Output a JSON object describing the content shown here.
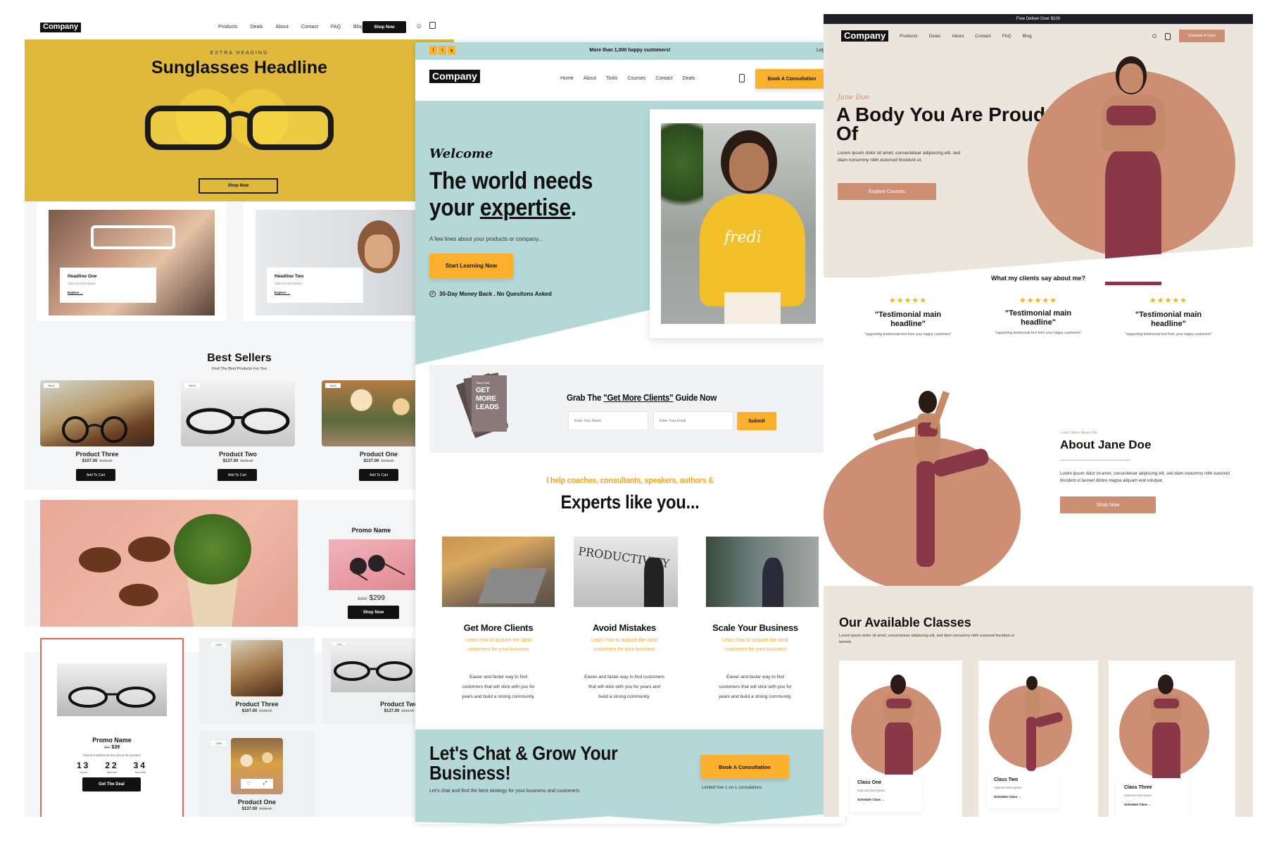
{
  "eyewear": {
    "logo": "Company",
    "nav": [
      "Products",
      "Deals",
      "About",
      "Contact",
      "FAQ",
      "Blog"
    ],
    "nav_cta": "Shop Now",
    "hero": {
      "eyebrow": "EXTRA HEADING",
      "title": "Sunglasses Headline",
      "cta": "Shop Now",
      "bg_color": "#e0b93c"
    },
    "features": [
      {
        "title": "Headline One",
        "desc": "Optional description",
        "link": "Explore →"
      },
      {
        "title": "Headline Two",
        "desc": "Optional description",
        "link": "Explore →"
      }
    ],
    "best_sellers": {
      "title": "Best Sellers",
      "subtitle": "Find The Best Products For You",
      "badge": "SALE",
      "products": [
        {
          "name": "Product Three",
          "price": "$107.00",
          "old_price": "$128.00",
          "cta": "Add To Cart"
        },
        {
          "name": "Product Two",
          "price": "$137.00",
          "old_price": "$158.00",
          "cta": "Add To Cart"
        },
        {
          "name": "Product One",
          "price": "$137.00",
          "old_price": "$168.00",
          "cta": "Add To Cart"
        }
      ]
    },
    "promo": {
      "title": "Promo Name",
      "old_price": "$399",
      "price": "$299",
      "cta": "Shop Now"
    },
    "deal": {
      "title": "Promo Name",
      "old_price": "$59",
      "price": "$39",
      "desc": "Optional additional text about the product",
      "countdown": [
        {
          "value": "13",
          "label": "Hours"
        },
        {
          "value": "22",
          "label": "Minutes"
        },
        {
          "value": "34",
          "label": "Seconds"
        }
      ],
      "cta": "Get The Deal"
    },
    "mini_products": [
      {
        "name": "Product Three",
        "price": "$107.00",
        "old_price": "$128.00",
        "badge": "-15%"
      },
      {
        "name": "Product Two",
        "price": "$137.00",
        "old_price": "$158.00",
        "badge": "-15%"
      },
      {
        "name": "Product One",
        "price": "$137.00",
        "old_price": "$168.00",
        "badge": "-15%"
      }
    ]
  },
  "coach": {
    "topbar": {
      "text": "More than 1,000 happy customers!",
      "login": "Log In",
      "social": [
        "f",
        "t",
        "ig"
      ]
    },
    "logo": "Company",
    "nav": [
      "Home",
      "About",
      "Tools",
      "Courses",
      "Contact",
      "Deals"
    ],
    "nav_cta": "Book A Consultation",
    "hero": {
      "script": "Welcome",
      "title_line1": "The world needs",
      "title_line2_pre": "your ",
      "title_line2_underlined": "expertise",
      "title_line2_post": ".",
      "subtitle": "A few lines about your products or company...",
      "cta": "Start Learning Now",
      "guarantee": "30-Day Money Back . No Quesitons Asked",
      "sweater_text": "fredi",
      "accent_color": "#b4d8d8"
    },
    "optin": {
      "book_small": "Tools & Deal",
      "book_lines": [
        "GET",
        "MORE",
        "LEADS"
      ],
      "title_pre": "Grab The ",
      "title_link": "\"Get More Clients\"",
      "title_post": " Guide Now",
      "name_placeholder": "Enter Your Name",
      "email_placeholder": "Enter Your Email",
      "submit": "Submit"
    },
    "experts": {
      "eyebrow": "I help coaches, consultants, speakers, authors &",
      "title": "Experts like you...",
      "cards": [
        {
          "title": "Get More Clients",
          "subtitle": "Learn how to acquire the ideal customers for your business",
          "body": "Easier and faster way to find customers that will stick with you for years and build a strong community."
        },
        {
          "title": "Avoid Mistakes",
          "subtitle": "Learn how to acquire the ideal customers for your business",
          "body": "Easier and faster way to find customers that will stick with you for years and build a strong community."
        },
        {
          "title": "Scale Your Business",
          "subtitle": "Learn how to acquire the ideal customers for your business",
          "body": "Easier and faster way to find customers that will stick with you for years and build a strong community."
        }
      ]
    },
    "cta_band": {
      "title": "Let's Chat & Grow Your Business!",
      "subtitle": "Let's chat and find the best strategy for your business and customers",
      "button": "Book A Consultation",
      "note": "Limited free 1-on-1 consulations"
    }
  },
  "fitness": {
    "topbar": "Free Deliver Over $100",
    "logo": "Company",
    "nav": [
      "Products",
      "Deals",
      "About",
      "Contact",
      "FAQ",
      "Blog"
    ],
    "nav_cta": "Schedule A Class",
    "hero": {
      "script": "Jane Doe",
      "title": "A Body You Are Proud Of",
      "body": "Lorem ipsum dolor sit amet, consectetuer adipiscing elit, sed diam nonummy nibh euismod tincidunt ut.",
      "cta": "Explore Courses"
    },
    "testimonials": {
      "title": "What my clients say about me?",
      "items": [
        {
          "rating": 5,
          "headline": "\"Testimonial main headline\"",
          "text": "\"supporting testimonial text from your happy customers\""
        },
        {
          "rating": 5,
          "headline": "\"Testimonial main headline\"",
          "text": "\"supporting testimonial text from your happy customers\""
        },
        {
          "rating": 5,
          "headline": "\"Testimonial main headline\"",
          "text": "\"supporting testimonial text from your happy customers\""
        }
      ]
    },
    "about": {
      "eyebrow": "Learn More About Me",
      "title": "About Jane Doe",
      "body": "Lorem ipsum dolor sit amet, consectetuer adipiscing elit, sed diam nonummy nibh euismod tincidunt ut laoreet dolore magna aliquam erat volutpat.",
      "cta": "Shop Now"
    },
    "classes": {
      "title": "Our Available Classes",
      "body": "Lorem ipsum dolor sit amet, consectetuer adipiscing elit, sed diam nonummy nibh euismod tincidunt ut laoreet.",
      "items": [
        {
          "title": "Class One",
          "desc": "Optional description",
          "link": "Schedule Class →"
        },
        {
          "title": "Class Two",
          "desc": "Optional description",
          "link": "Schedule Class →"
        },
        {
          "title": "Class Three",
          "desc": "Optional description",
          "link": "Schedule Class →"
        }
      ]
    },
    "accent_color": "#cd8f74",
    "bg_color": "#ece5dc"
  }
}
